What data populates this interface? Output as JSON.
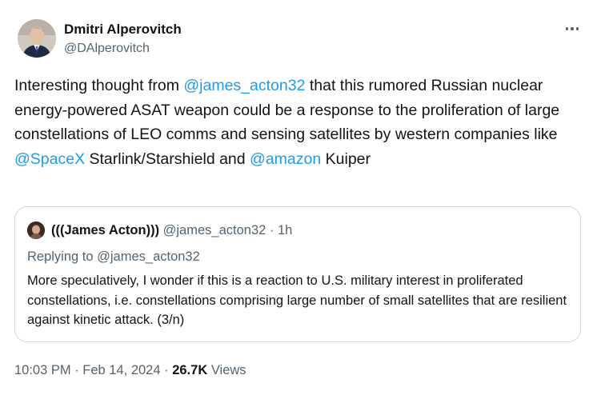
{
  "author": {
    "display_name": "Dmitri Alperovitch",
    "handle": "@DAlperovitch"
  },
  "more_icon": "more-horizontal-icon",
  "tweet": {
    "segments": [
      {
        "text": "Interesting thought from ",
        "link": false
      },
      {
        "text": "@james_acton32",
        "link": true
      },
      {
        "text": " that this rumored Russian nuclear energy-powered ASAT weapon could be a response to the proliferation of large constellations of LEO comms and sensing satellites by western companies like ",
        "link": false
      },
      {
        "text": "@SpaceX",
        "link": true
      },
      {
        "text": " Starlink/Starshield and ",
        "link": false
      },
      {
        "text": "@amazon",
        "link": true
      },
      {
        "text": " Kuiper",
        "link": false
      }
    ]
  },
  "quote": {
    "display_name": "(((James Acton)))",
    "meta": " @james_acton32 · 1h",
    "replying_to": "Replying to @james_acton32",
    "text": "More speculatively, I wonder if this is a reaction to U.S. military interest in proliferated constellations, i.e. constellations comprising large number of small satellites that are resilient against kinetic attack. (3/n)"
  },
  "footer": {
    "timestamp": "10:03 PM · Feb 14, 2024 · ",
    "views_count": "26.7K",
    "views_label": " Views"
  },
  "colors": {
    "link": "#1d9bf0",
    "secondary_text": "#536471",
    "primary_text": "#0f1419",
    "border": "#cfd9de"
  }
}
